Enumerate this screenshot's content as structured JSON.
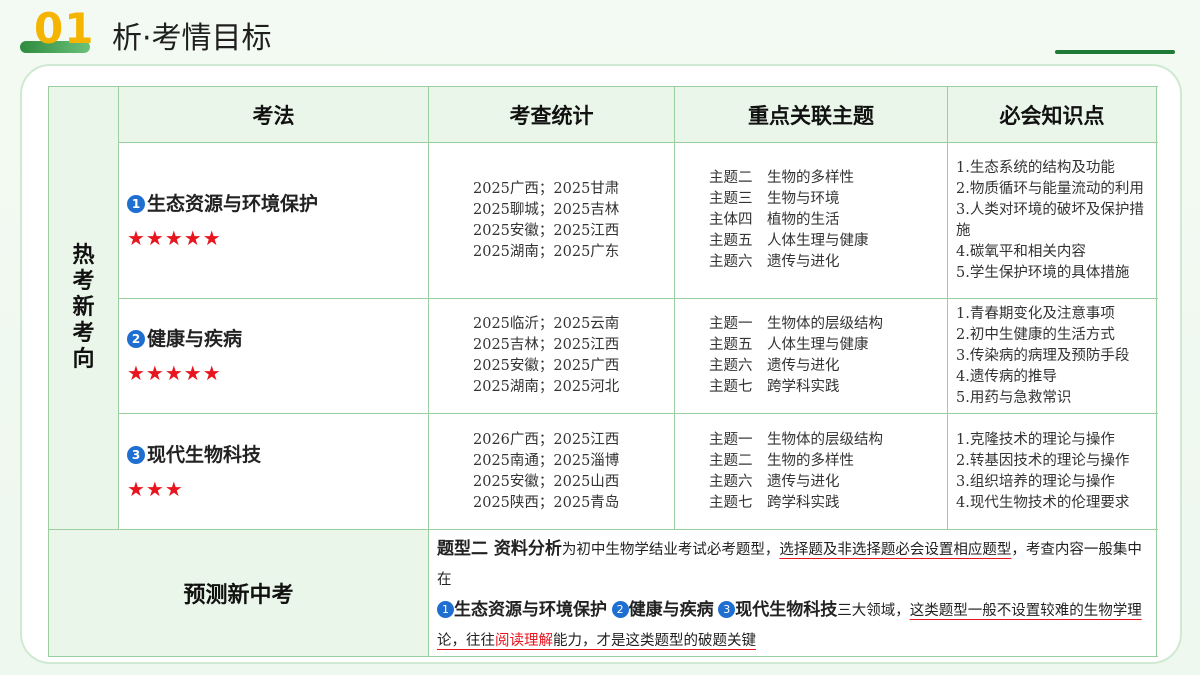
{
  "header": {
    "number": "01",
    "title": "析·考情目标"
  },
  "side_label": "热考新考向",
  "table_headers": [
    "考法",
    "考查统计",
    "重点关联主题",
    "必会知识点"
  ],
  "rows": [
    {
      "badge": "1",
      "method": "生态资源与环境保护",
      "stars": "★★★★★",
      "stats": [
        "2025广西；2025甘肃",
        "2025聊城；2025吉林",
        "2025安徽；2025江西",
        "2025湖南；2025广东"
      ],
      "topics": [
        "主题二　生物的多样性",
        "主题三　生物与环境",
        "主体四　植物的生活",
        "主题五　人体生理与健康",
        "主题六　遗传与进化"
      ],
      "knowledge": [
        "1.生态系统的结构及功能",
        "2.物质循环与能量流动的利用",
        "3.人类对环境的破坏及保护措施",
        "4.碳氧平和相关内容",
        "5.学生保护环境的具体措施"
      ]
    },
    {
      "badge": "2",
      "method": "健康与疾病",
      "stars": "★★★★★",
      "stats": [
        "2025临沂；2025云南",
        "2025吉林；2025江西",
        "2025安徽；2025广西",
        "2025湖南；2025河北"
      ],
      "topics": [
        "主题一　生物体的层级结构",
        "主题五　人体生理与健康",
        "主题六　遗传与进化",
        "主题七　跨学科实践"
      ],
      "knowledge": [
        "1.青春期变化及注意事项",
        "2.初中生健康的生活方式",
        "3.传染病的病理及预防手段",
        "4.遗传病的推导",
        "5.用药与急救常识"
      ]
    },
    {
      "badge": "3",
      "method": "现代生物科技",
      "stars": "★★★",
      "stats": [
        "2026广西；2025江西",
        "2025南通；2025淄博",
        "2025安徽；2025山西",
        "2025陕西；2025青岛"
      ],
      "topics": [
        "主题一　生物体的层级结构",
        "主题二　生物的多样性",
        "主题六　遗传与进化",
        "主题七　跨学科实践"
      ],
      "knowledge": [
        "1.克隆技术的理论与操作",
        "2.转基因技术的理论与操作",
        "3.组织培养的理论与操作",
        "4.现代生物技术的伦理要求"
      ]
    }
  ],
  "predict": {
    "label": "预测新中考",
    "type_bold": "题型二 资料分析",
    "t1": "为初中生物学结业考试必考题型，",
    "t2": "选择题及非选择题必会设置相应题型",
    "t3": "，考查内容一般集中在",
    "b1_num": "1",
    "b1": "生态资源与环境保护",
    "b2_num": "2",
    "b2": "健康与疾病",
    "b3_num": "3",
    "b3": "现代生物科技",
    "t4": "三大领域，",
    "t5": "这类题型一般不设置较难的生物学理论，往往",
    "t6": "阅读理解",
    "t7": "能力，才是这类题型的破题关键"
  }
}
